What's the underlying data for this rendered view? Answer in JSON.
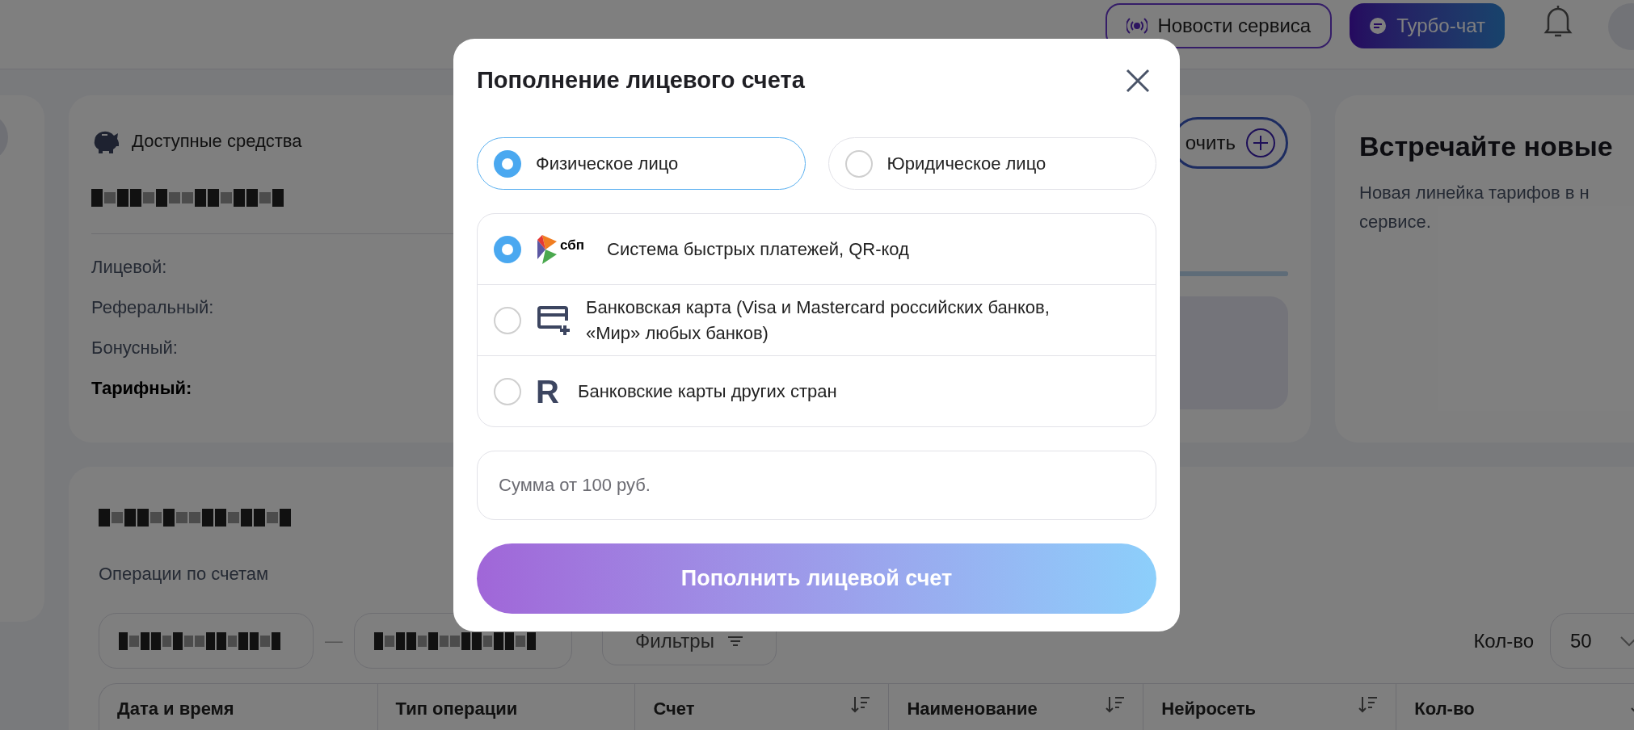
{
  "header": {
    "buttons": [
      {
        "label": "Новости сервиса",
        "kind": "outline"
      },
      {
        "label": "Турбо-чат",
        "kind": "filled"
      }
    ]
  },
  "balance_card": {
    "title": "Доступные средства",
    "accounts": [
      {
        "label": "Лицевой:",
        "emphasized": false
      },
      {
        "label": "Реферальный:",
        "emphasized": false
      },
      {
        "label": "Бонусный:",
        "emphasized": false
      },
      {
        "label": "Тарифный:",
        "emphasized": true
      }
    ]
  },
  "topup_card": {
    "button": "очить",
    "progress": {
      "level": 1
    }
  },
  "promo_card": {
    "title": "Встречайте новые",
    "lines": [
      "Новая линейка тарифов в н",
      "сервисе."
    ]
  },
  "operations": {
    "subtitle": "Операции по счетам",
    "date_separator": "—",
    "filters_button": "Фильтры",
    "page_size_label": "Кол-во",
    "page_size": "50",
    "columns": [
      {
        "label": "Дата и время",
        "sortable": false
      },
      {
        "label": "Тип операции",
        "sortable": false
      },
      {
        "label": "Счет",
        "sortable": true
      },
      {
        "label": "Наименование",
        "sortable": true
      },
      {
        "label": "Нейросеть",
        "sortable": true
      },
      {
        "label": "Кол-во",
        "sortable": true
      }
    ]
  },
  "modal": {
    "title": "Пополнение лицевого счета",
    "entity_types": [
      {
        "label": "Физическое лицо",
        "selected": true
      },
      {
        "label": "Юридическое лицо",
        "selected": false
      }
    ],
    "payment_methods": [
      {
        "kind": "sbp",
        "logo_text": "сбп",
        "label": "Система быстрых платежей, QR-код",
        "selected": true
      },
      {
        "kind": "card",
        "label": "Банковская карта (Visa и Mastercard российских банков, «Мир» любых банков)",
        "selected": false
      },
      {
        "kind": "foreign",
        "icon_text": "R",
        "label": "Банковские карты других стран",
        "selected": false
      }
    ],
    "amount": {
      "placeholder": "Сумма от 100 руб."
    },
    "submit": "Пополнить лицевой счет"
  }
}
